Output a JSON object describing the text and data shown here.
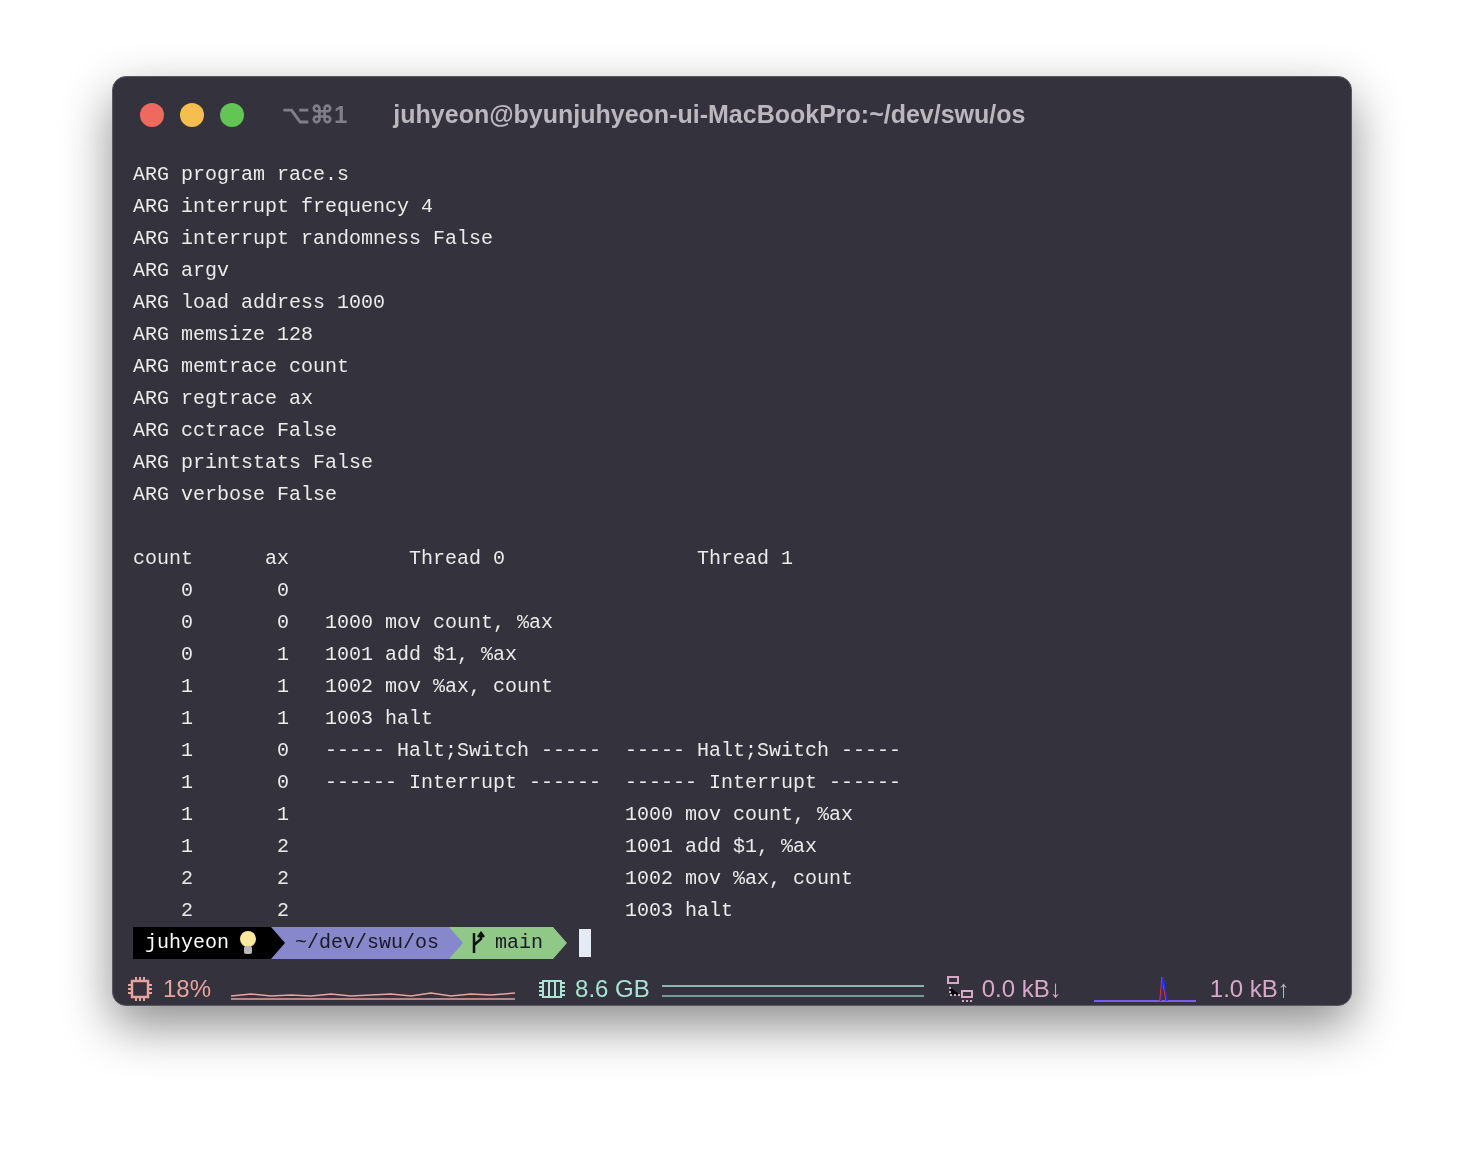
{
  "window": {
    "title": "juhyeon@byunjuhyeon-ui-MacBookPro:~/dev/swu/os",
    "shortcut": "⌥⌘1"
  },
  "args": [
    "ARG program race.s",
    "ARG interrupt frequency 4",
    "ARG interrupt randomness False",
    "ARG argv",
    "ARG load address 1000",
    "ARG memsize 128",
    "ARG memtrace count",
    "ARG regtrace ax",
    "ARG cctrace False",
    "ARG printstats False",
    "ARG verbose False"
  ],
  "table": [
    "count      ax          Thread 0                Thread 1",
    "    0       0",
    "    0       0   1000 mov count, %ax",
    "    0       1   1001 add $1, %ax",
    "    1       1   1002 mov %ax, count",
    "    1       1   1003 halt",
    "    1       0   ----- Halt;Switch -----  ----- Halt;Switch -----",
    "    1       0   ------ Interrupt ------  ------ Interrupt ------",
    "    1       1                            1000 mov count, %ax",
    "    1       2                            1001 add $1, %ax",
    "    2       2                            1002 mov %ax, count",
    "    2       2                            1003 halt"
  ],
  "prompt": {
    "user": "juhyeon",
    "path": "~/dev/swu/os",
    "branch": "main"
  },
  "status": {
    "cpu": "18%",
    "memory": "8.6 GB",
    "net_down": "0.0 kB↓",
    "net_up": "1.0 kB↑"
  }
}
